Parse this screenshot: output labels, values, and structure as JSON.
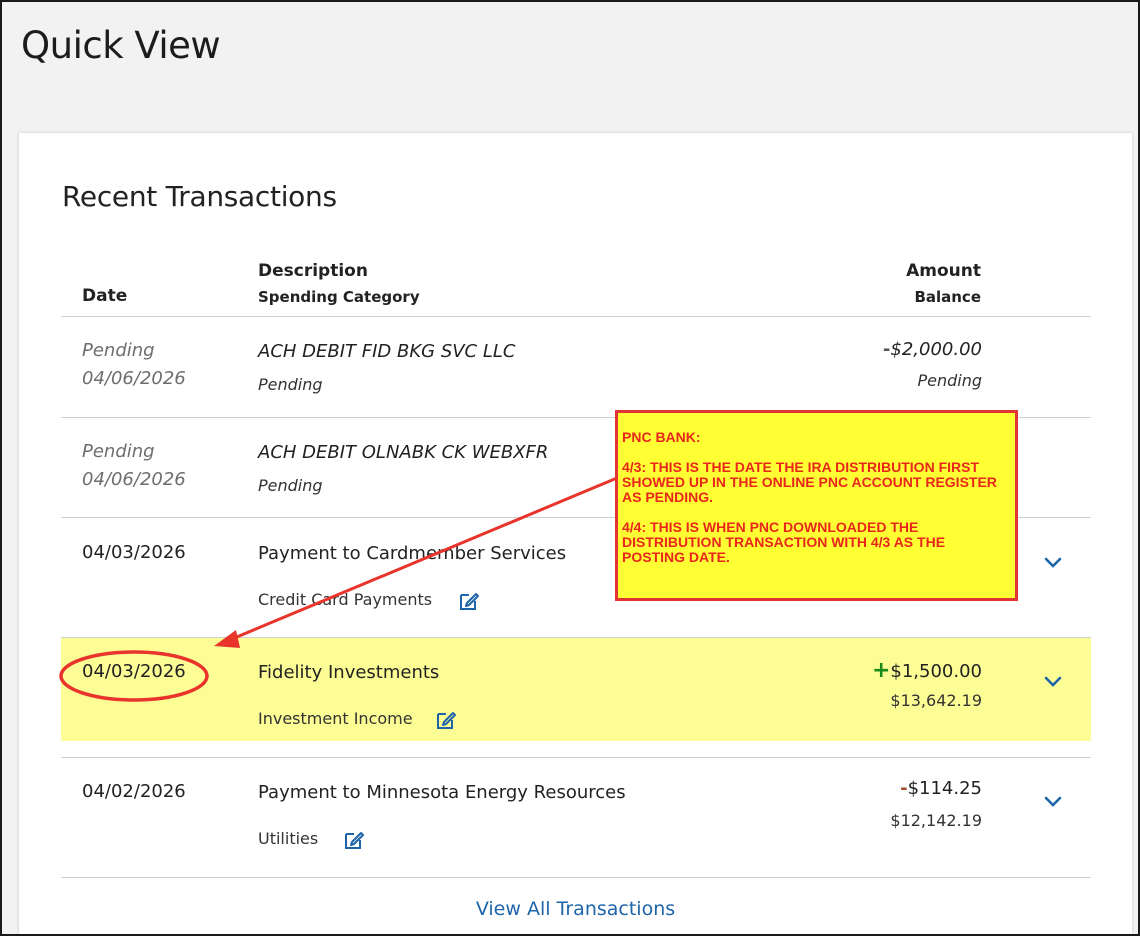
{
  "page": {
    "title": "Quick View"
  },
  "card": {
    "title": "Recent Transactions",
    "columns": {
      "date": "Date",
      "description": "Description",
      "category": "Spending Category",
      "amount": "Amount",
      "balance": "Balance"
    },
    "view_all_label": "View All Transactions"
  },
  "transactions": [
    {
      "date_line1": "Pending",
      "date_line2": "04/06/2026",
      "description": "ACH DEBIT FID BKG SVC LLC",
      "category": "Pending",
      "amount_sign": "-",
      "amount": "$2,000.00",
      "balance": "Pending"
    },
    {
      "date_line1": "Pending",
      "date_line2": "04/06/2026",
      "description": "ACH DEBIT OLNABK CK WEBXFR",
      "category": "Pending"
    },
    {
      "date": "04/03/2026",
      "description": "Payment to Cardmember Services",
      "category": "Credit Card Payments"
    },
    {
      "date": "04/03/2026",
      "description": "Fidelity Investments",
      "category": "Investment Income",
      "amount_sign": "+",
      "amount": "$1,500.00",
      "balance": "$13,642.19"
    },
    {
      "date": "04/02/2026",
      "description": "Payment to Minnesota Energy Resources",
      "category": "Utilities",
      "amount_sign": "-",
      "amount": "$114.25",
      "balance": "$12,142.19"
    }
  ],
  "annotation": {
    "heading": "PNC BANK:",
    "para1": "4/3:  THIS IS THE DATE THE IRA DISTRIBUTION FIRST SHOWED UP IN THE ONLINE PNC ACCOUNT REGISTER AS PENDING.",
    "para2": "4/4:  THIS IS WHEN PNC DOWNLOADED THE DISTRIBUTION TRANSACTION WITH 4/3 AS THE POSTING DATE."
  },
  "colors": {
    "link": "#1d64a9",
    "highlight": "#fdfd96",
    "annotation_bg": "#ffff33",
    "annotation_red": "#e8261c",
    "plus_green": "#1a8a1a",
    "minus_brown": "#a0522d"
  },
  "icons": [
    "edit-icon",
    "chevron-down-icon"
  ]
}
